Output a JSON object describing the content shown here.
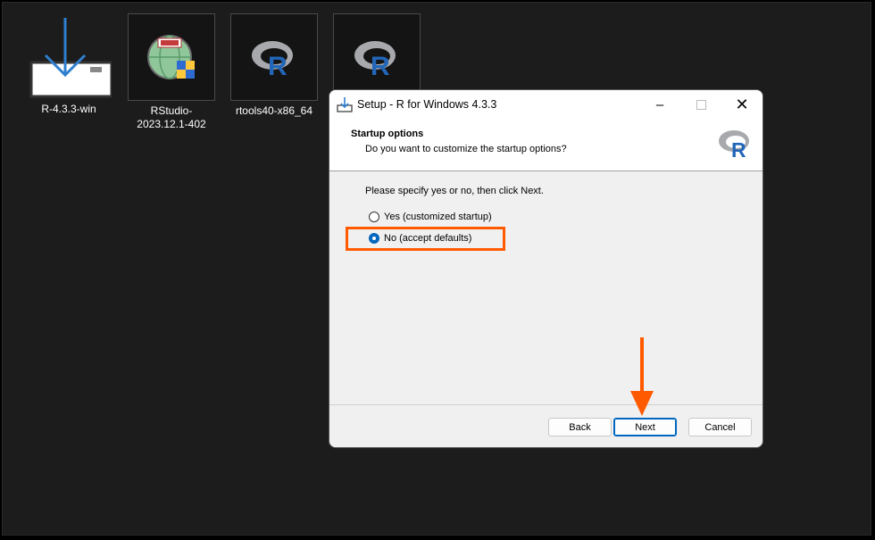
{
  "desktop": {
    "icons": [
      {
        "label": "R-4.3.3-win",
        "icon": "installer-download-icon"
      },
      {
        "label": "RStudio-2023.12.1-402",
        "icon": "setup-globe-icon"
      },
      {
        "label": "rtools40-x86_64",
        "icon": "r-logo-icon"
      },
      {
        "label": "",
        "icon": "r-logo-icon"
      }
    ]
  },
  "dialog": {
    "title": "Setup - R for Windows 4.3.3",
    "header_title": "Startup options",
    "header_subtitle": "Do you want to customize the startup options?",
    "instruction": "Please specify yes or no, then click Next.",
    "options": [
      {
        "label": "Yes (customized startup)",
        "checked": false
      },
      {
        "label": "No (accept defaults)",
        "checked": true
      }
    ],
    "buttons": {
      "back": "Back",
      "next": "Next",
      "cancel": "Cancel"
    }
  },
  "colors": {
    "annotation": "#ff5a00",
    "accent": "#0067c0",
    "r_blue": "#2266b8"
  }
}
